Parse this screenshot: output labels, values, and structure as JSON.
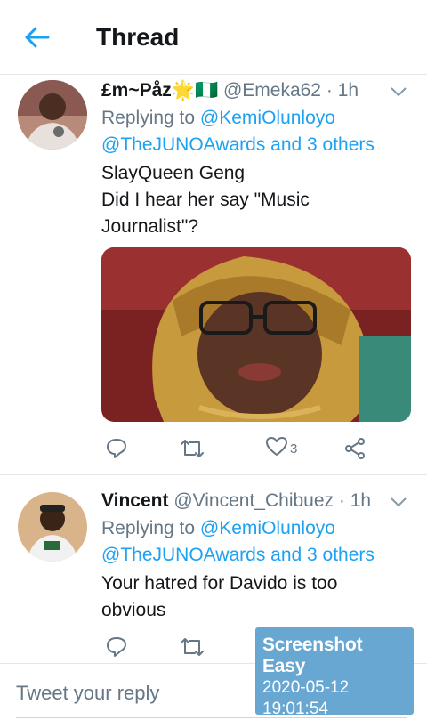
{
  "header": {
    "title": "Thread",
    "back_icon": "arrow-left-icon",
    "accent": "#1da1f2"
  },
  "tweets": [
    {
      "display_name": "£m~Påz",
      "name_emoji": "🌟🇳🇬",
      "handle": "@Emeka62",
      "separator": "·",
      "time": "1h",
      "replying_prefix": "Replying to",
      "mention_1": "@KemiOlunloyo",
      "mention_2": "@TheJUNOAwards and 3 others",
      "text_lines": [
        "SlayQueen Geng",
        "Did I hear her say \"Music",
        "Journalist\"?"
      ],
      "like_count": "3"
    },
    {
      "display_name": "Vincent",
      "handle": "@Vincent_Chibuez",
      "separator": "·",
      "time": "1h",
      "replying_prefix": "Replying to",
      "mention_1": "@KemiOlunloyo",
      "mention_2": "@TheJUNOAwards and 3 others",
      "text_lines": [
        "Your hatred for Davido is too",
        "obvious"
      ]
    }
  ],
  "reply": {
    "placeholder": "Tweet your reply"
  },
  "watermark": {
    "title": "Screenshot Easy",
    "date": "2020-05-12",
    "time": "19:01:54"
  }
}
